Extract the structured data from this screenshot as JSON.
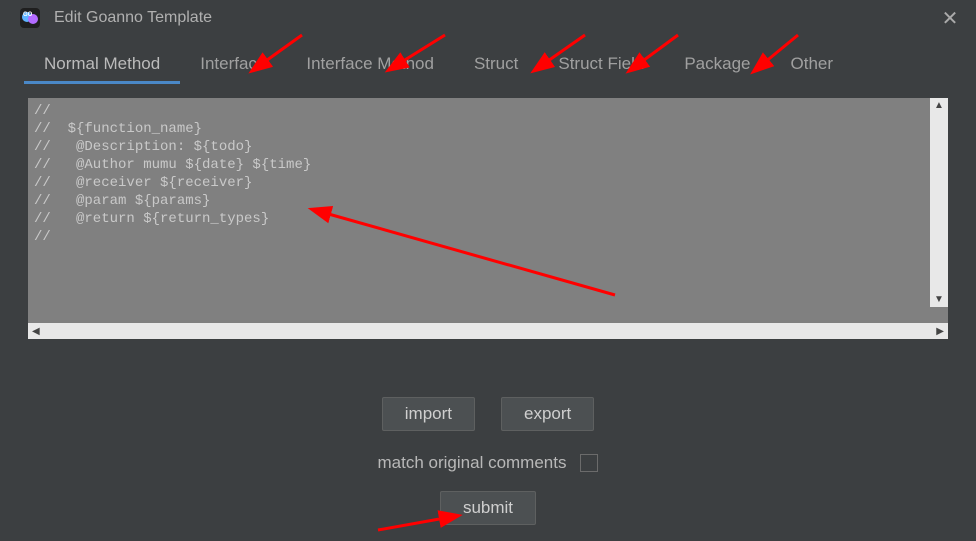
{
  "window": {
    "title": "Edit Goanno Template"
  },
  "tabs": {
    "items": [
      {
        "label": "Normal Method",
        "active": true
      },
      {
        "label": "Interface",
        "active": false
      },
      {
        "label": "Interface Method",
        "active": false
      },
      {
        "label": "Struct",
        "active": false
      },
      {
        "label": "Struct Field",
        "active": false
      },
      {
        "label": "Package",
        "active": false
      },
      {
        "label": "Other",
        "active": false
      }
    ]
  },
  "editor": {
    "content": "//\n//  ${function_name}\n//   @Description: ${todo}\n//   @Author mumu ${date} ${time}\n//   @receiver ${receiver}\n//   @param ${params}\n//   @return ${return_types}\n//"
  },
  "buttons": {
    "import": "import",
    "export": "export",
    "submit": "submit"
  },
  "checkbox": {
    "label": "match original comments",
    "checked": false
  },
  "annotations": {
    "color": "#ff0000"
  }
}
